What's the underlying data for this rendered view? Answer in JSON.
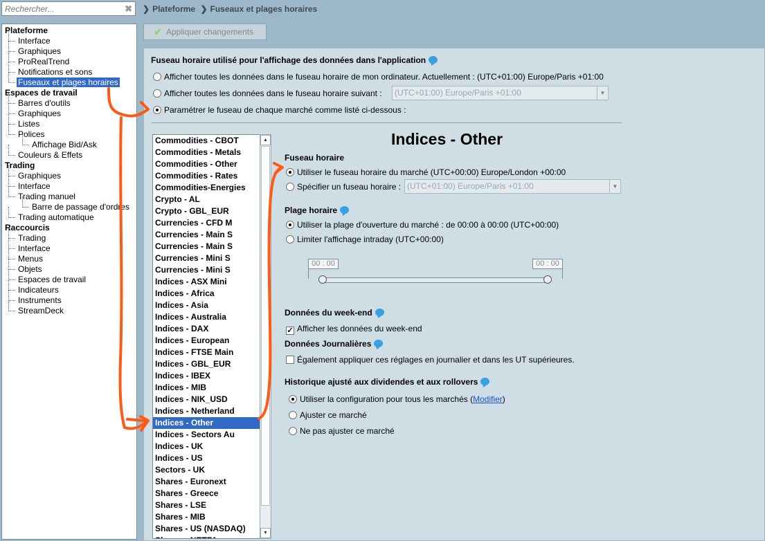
{
  "search": {
    "placeholder": "Rechercher..."
  },
  "tree": [
    {
      "label": "Plateforme",
      "level": 0
    },
    {
      "label": "Interface",
      "level": 1
    },
    {
      "label": "Graphiques",
      "level": 1
    },
    {
      "label": "ProRealTrend",
      "level": 1
    },
    {
      "label": "Notifications et sons",
      "level": 1
    },
    {
      "label": "Fuseaux et plages horaires",
      "level": 1,
      "selected": true
    },
    {
      "label": "Espaces de travail",
      "level": 0
    },
    {
      "label": "Barres d'outils",
      "level": 1
    },
    {
      "label": "Graphiques",
      "level": 1
    },
    {
      "label": "Listes",
      "level": 1
    },
    {
      "label": "Polices",
      "level": 1
    },
    {
      "label": "Affichage Bid/Ask",
      "level": 2
    },
    {
      "label": "Couleurs & Effets",
      "level": 1
    },
    {
      "label": "Trading",
      "level": 0
    },
    {
      "label": "Graphiques",
      "level": 1
    },
    {
      "label": "Interface",
      "level": 1
    },
    {
      "label": "Trading manuel",
      "level": 1
    },
    {
      "label": "Barre de passage d'ordres",
      "level": 2
    },
    {
      "label": "Trading automatique",
      "level": 1
    },
    {
      "label": "Raccourcis",
      "level": 0
    },
    {
      "label": "Trading",
      "level": 1
    },
    {
      "label": "Interface",
      "level": 1
    },
    {
      "label": "Menus",
      "level": 1
    },
    {
      "label": "Objets",
      "level": 1
    },
    {
      "label": "Espaces de travail",
      "level": 1
    },
    {
      "label": "Indicateurs",
      "level": 1
    },
    {
      "label": "Instruments",
      "level": 1
    },
    {
      "label": "StreamDeck",
      "level": 1
    }
  ],
  "breadcrumb": {
    "sep": "❯",
    "items": [
      "Plateforme",
      "Fuseaux et plages horaires"
    ]
  },
  "toolbar": {
    "apply_label": "Appliquer changements"
  },
  "global": {
    "title": "Fuseau horaire utilisé pour l'affichage des données dans l'application",
    "opt1": "Afficher toutes les données dans le fuseau horaire de mon ordinateur. Actuellement : (UTC+01:00) Europe/Paris +01:00",
    "opt2": "Afficher toutes les données dans le fuseau horaire suivant :",
    "opt2_select": "(UTC+01:00) Europe/Paris +01:00",
    "opt3": "Paramétrer le fuseau de chaque marché comme listé ci-dessous :",
    "selected_option": 3
  },
  "markets": [
    "Commodities - CBOT",
    "Commodities - Metals",
    "Commodities - Other",
    "Commodities - Rates",
    "Commodities-Energies",
    "Crypto - AL",
    "Crypto - GBL_EUR",
    "Currencies - CFD M",
    "Currencies - Main S",
    "Currencies - Main S",
    "Currencies - Mini S",
    "Currencies - Mini S",
    "Indices - ASX Mini",
    "Indices - Africa",
    "Indices - Asia",
    "Indices - Australia",
    "Indices - DAX",
    "Indices - European",
    "Indices - FTSE Main",
    "Indices - GBL_EUR",
    "Indices - IBEX",
    "Indices - MIB",
    "Indices - NIK_USD",
    "Indices - Netherland",
    "Indices - Other",
    "Indices - Sectors Au",
    "Indices - UK",
    "Indices - US",
    "Sectors - UK",
    "Shares - Euronext",
    "Shares - Greece",
    "Shares - LSE",
    "Shares - MIB",
    "Shares - US (NASDAQ)",
    "Shares - NETFA"
  ],
  "selected_market": "Indices - Other",
  "detail": {
    "title": "Indices - Other",
    "tz_heading": "Fuseau horaire",
    "tz_opt1": "Utiliser le fuseau horaire du marché (UTC+00:00) Europe/London +00:00",
    "tz_opt2": "Spécifier un fuseau horaire :",
    "tz_select": "(UTC+01:00) Europe/Paris +01:00",
    "hours_heading": "Plage horaire",
    "hours_opt1": "Utiliser la plage d'ouverture du marché : de 00:00 à 00:00  (UTC+00:00)",
    "hours_opt2": "Limiter l'affichage intraday (UTC+00:00)",
    "slider_start": "00 : 00",
    "slider_end": "00 : 00",
    "weekend_heading": "Données du week-end",
    "weekend_check": "Afficher les données du week-end",
    "weekend_checked": true,
    "daily_heading": "Données Journalières",
    "daily_check": "Également appliquer ces réglages en journalier et dans les UT supérieures.",
    "daily_checked": false,
    "hist_heading": "Historique ajusté aux dividendes et aux rollovers",
    "hist_opt1_prefix": "Utiliser la configuration pour tous les marchés (",
    "hist_opt1_link": "Modifier",
    "hist_opt1_suffix": ")",
    "hist_opt2": "Ajuster ce marché",
    "hist_opt3": "Ne pas ajuster ce marché"
  },
  "colors": {
    "annotation": "#ff5a14",
    "selection": "#316ac5"
  }
}
